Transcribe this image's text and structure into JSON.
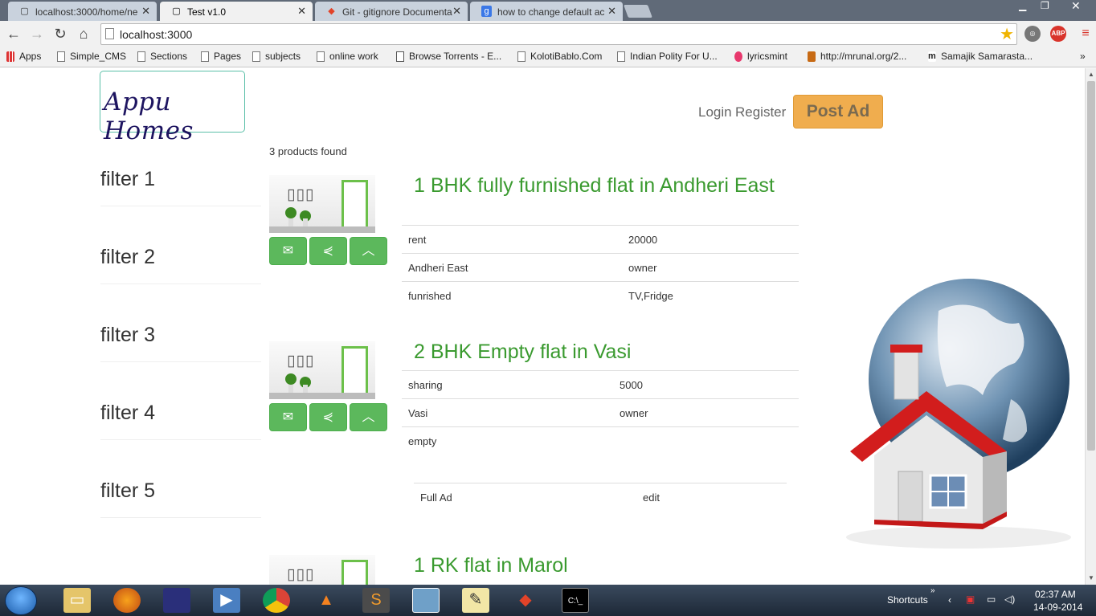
{
  "browser": {
    "tabs": [
      {
        "title": "localhost:3000/home/ne",
        "active": false
      },
      {
        "title": "Test v1.0",
        "active": true
      },
      {
        "title": "Git - gitignore Documenta",
        "active": false
      },
      {
        "title": "how to change default ac",
        "active": false
      }
    ],
    "url": "localhost:3000",
    "extensions": [
      "ABP"
    ],
    "bookmarks": [
      {
        "label": "Apps"
      },
      {
        "label": "Simple_CMS"
      },
      {
        "label": "Sections"
      },
      {
        "label": "Pages"
      },
      {
        "label": "subjects"
      },
      {
        "label": "online work"
      },
      {
        "label": "Browse Torrents - E..."
      },
      {
        "label": "KolotiBablo.Com"
      },
      {
        "label": "Indian Polity For U..."
      },
      {
        "label": "lyricsmint"
      },
      {
        "label": "http://mrunal.org/2..."
      },
      {
        "label": "Samajik Samarasta..."
      }
    ],
    "bookmarks_overflow": "»"
  },
  "site": {
    "logo_text": "Appu Homes",
    "login": "Login",
    "register": "Register",
    "post_ad": "Post Ad",
    "count_text": "3 products found",
    "filters": [
      "filter 1",
      "filter 2",
      "filter 3",
      "filter 4",
      "filter 5"
    ],
    "products": [
      {
        "title": "1 BHK fully furnished flat in Andheri East",
        "rows": [
          [
            "rent",
            "20000"
          ],
          [
            "Andheri East",
            "owner"
          ],
          [
            "funrished",
            "TV,Fridge"
          ]
        ]
      },
      {
        "title": "2 BHK Empty flat in Vasi",
        "rows": [
          [
            "sharing",
            "5000"
          ],
          [
            "Vasi",
            "owner"
          ],
          [
            "empty",
            ""
          ]
        ],
        "footer": [
          "Full Ad",
          "edit"
        ]
      },
      {
        "title": "1 RK flat in Marol"
      }
    ],
    "thumb_frames": "▯▯▯"
  },
  "taskbar": {
    "shortcuts_label": "Shortcuts",
    "time": "02:37 AM",
    "date": "14-09-2014"
  },
  "colors": {
    "accent_green": "#5cb85c",
    "title_green": "#3a9a2f",
    "post_ad_orange": "#f0ad4e",
    "logo_border": "#5bc0a8"
  }
}
